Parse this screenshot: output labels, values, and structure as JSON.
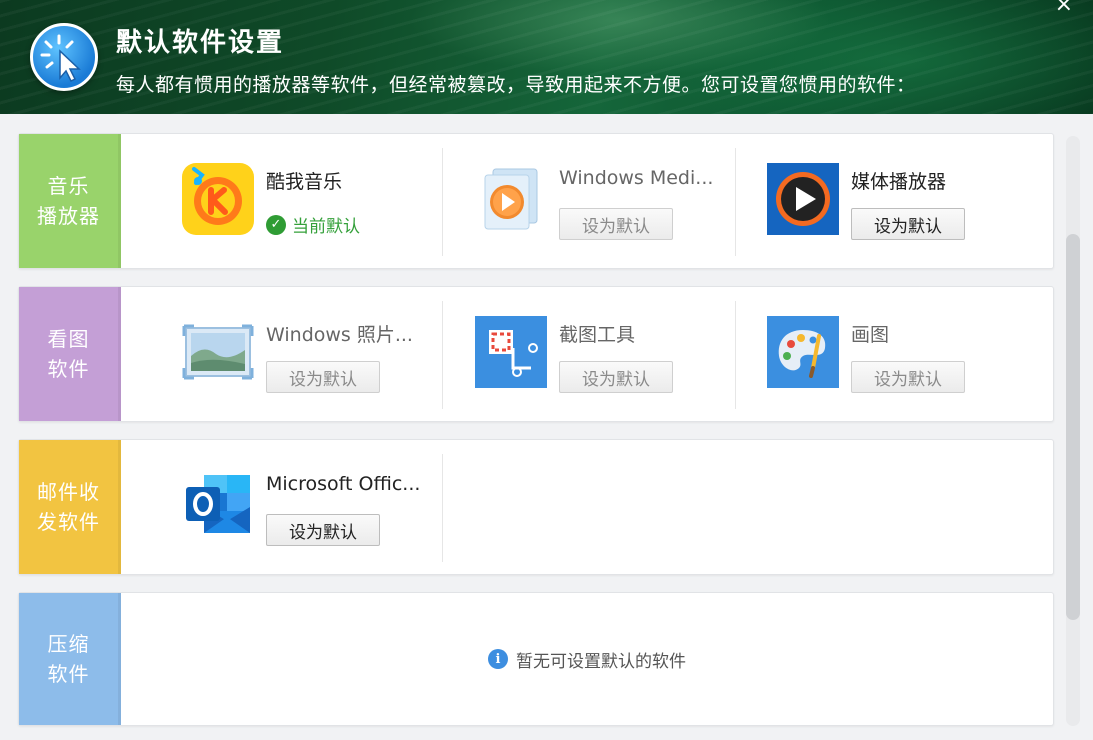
{
  "header": {
    "title": "默认软件设置",
    "subtitle": "每人都有惯用的播放器等软件，但经常被篡改，导致用起来不方便。您可设置您惯用的软件：",
    "logo_icon": "cursor-click-icon",
    "close_label": "×"
  },
  "categories": [
    {
      "label_lines": [
        "音乐",
        "播放器"
      ],
      "color": "#99d36b",
      "apps": [
        {
          "name": "酷我音乐",
          "status": "当前默认",
          "icon": "kuwo-music-icon",
          "is_default": true
        },
        {
          "name": "Windows Medi...",
          "button": "设为默认",
          "icon": "windows-media-player-icon",
          "is_default": false
        },
        {
          "name": "媒体播放器",
          "button": "设为默认",
          "icon": "media-player-icon",
          "is_default": false
        }
      ]
    },
    {
      "label_lines": [
        "看图",
        "软件"
      ],
      "color": "#c49fd6",
      "apps": [
        {
          "name": "Windows 照片...",
          "button": "设为默认",
          "icon": "windows-photos-icon",
          "is_default": false
        },
        {
          "name": "截图工具",
          "button": "设为默认",
          "icon": "snipping-tool-icon",
          "is_default": false
        },
        {
          "name": "画图",
          "button": "设为默认",
          "icon": "paint-icon",
          "is_default": false
        }
      ]
    },
    {
      "label_lines": [
        "邮件收",
        "发软件"
      ],
      "color": "#f2c441",
      "apps": [
        {
          "name": "Microsoft Offic...",
          "button": "设为默认",
          "icon": "outlook-icon",
          "is_default": false
        }
      ]
    },
    {
      "label_lines": [
        "压缩",
        "软件"
      ],
      "color": "#8dbcea",
      "empty_message": "暂无可设置默认的软件",
      "empty_icon": "info-icon"
    }
  ]
}
